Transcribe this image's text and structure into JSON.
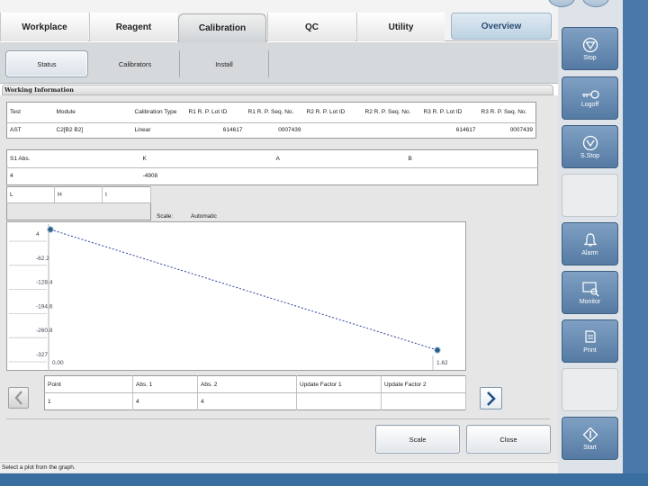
{
  "top_tabs": [
    {
      "label": "Workplace"
    },
    {
      "label": "Reagent"
    },
    {
      "label": "Calibration"
    },
    {
      "label": "QC"
    },
    {
      "label": "Utility"
    }
  ],
  "overview_label": "Overview",
  "sub_tabs": [
    {
      "label": "Status"
    },
    {
      "label": "Calibrators"
    },
    {
      "label": "Install"
    }
  ],
  "section_title": "Working Information",
  "cal_table": {
    "headers": [
      "Test",
      "Module",
      "Calibration Type",
      "R1 R. P. Lot ID",
      "R1 R. P. Seq. No.",
      "R2 R. P. Lot ID",
      "R2 R. P. Seq. No.",
      "R3 R. P. Lot ID",
      "R3 R. P. Seq. No."
    ],
    "row": [
      "AST",
      "C2[B2 B2]",
      "Linear",
      "614617",
      "0007439",
      "",
      "",
      "614617",
      "0007439"
    ]
  },
  "abs_table": {
    "headers": [
      "S1 Abs.",
      "K",
      "A",
      "B"
    ],
    "row": [
      "4",
      "-4908",
      "",
      ""
    ]
  },
  "lhi_table": {
    "headers": [
      "L",
      "H",
      "I"
    ]
  },
  "scale": {
    "label": "Scale:",
    "value": "Automatic"
  },
  "chart_data": {
    "type": "line",
    "x": [
      0.0,
      1.62
    ],
    "y": [
      4,
      -327
    ],
    "y_ticks": [
      "4",
      "-62.2",
      "-128.4",
      "-194.6",
      "-260.8",
      "-327"
    ],
    "x_ticks": [
      "0.00",
      "1.62"
    ],
    "xlim": [
      0.0,
      1.62
    ],
    "ylim": [
      -327,
      4
    ],
    "line_color": "#2e3f9e",
    "marker_color": "#2c5f86"
  },
  "point_table": {
    "headers": [
      "Point",
      "Abs. 1",
      "Abs. 2",
      "Update Factor 1",
      "Update Factor 2"
    ],
    "row": [
      "1",
      "4",
      "4",
      "",
      ""
    ]
  },
  "buttons": {
    "scale": "Scale",
    "close": "Close"
  },
  "status_text": "Select a plot from the graph.",
  "side_buttons": {
    "stop": "Stop",
    "logoff": "Logoff",
    "s_stop": "S.Stop",
    "alarm": "Alarm",
    "monitor": "Monitor",
    "print": "Print",
    "start": "Start"
  }
}
